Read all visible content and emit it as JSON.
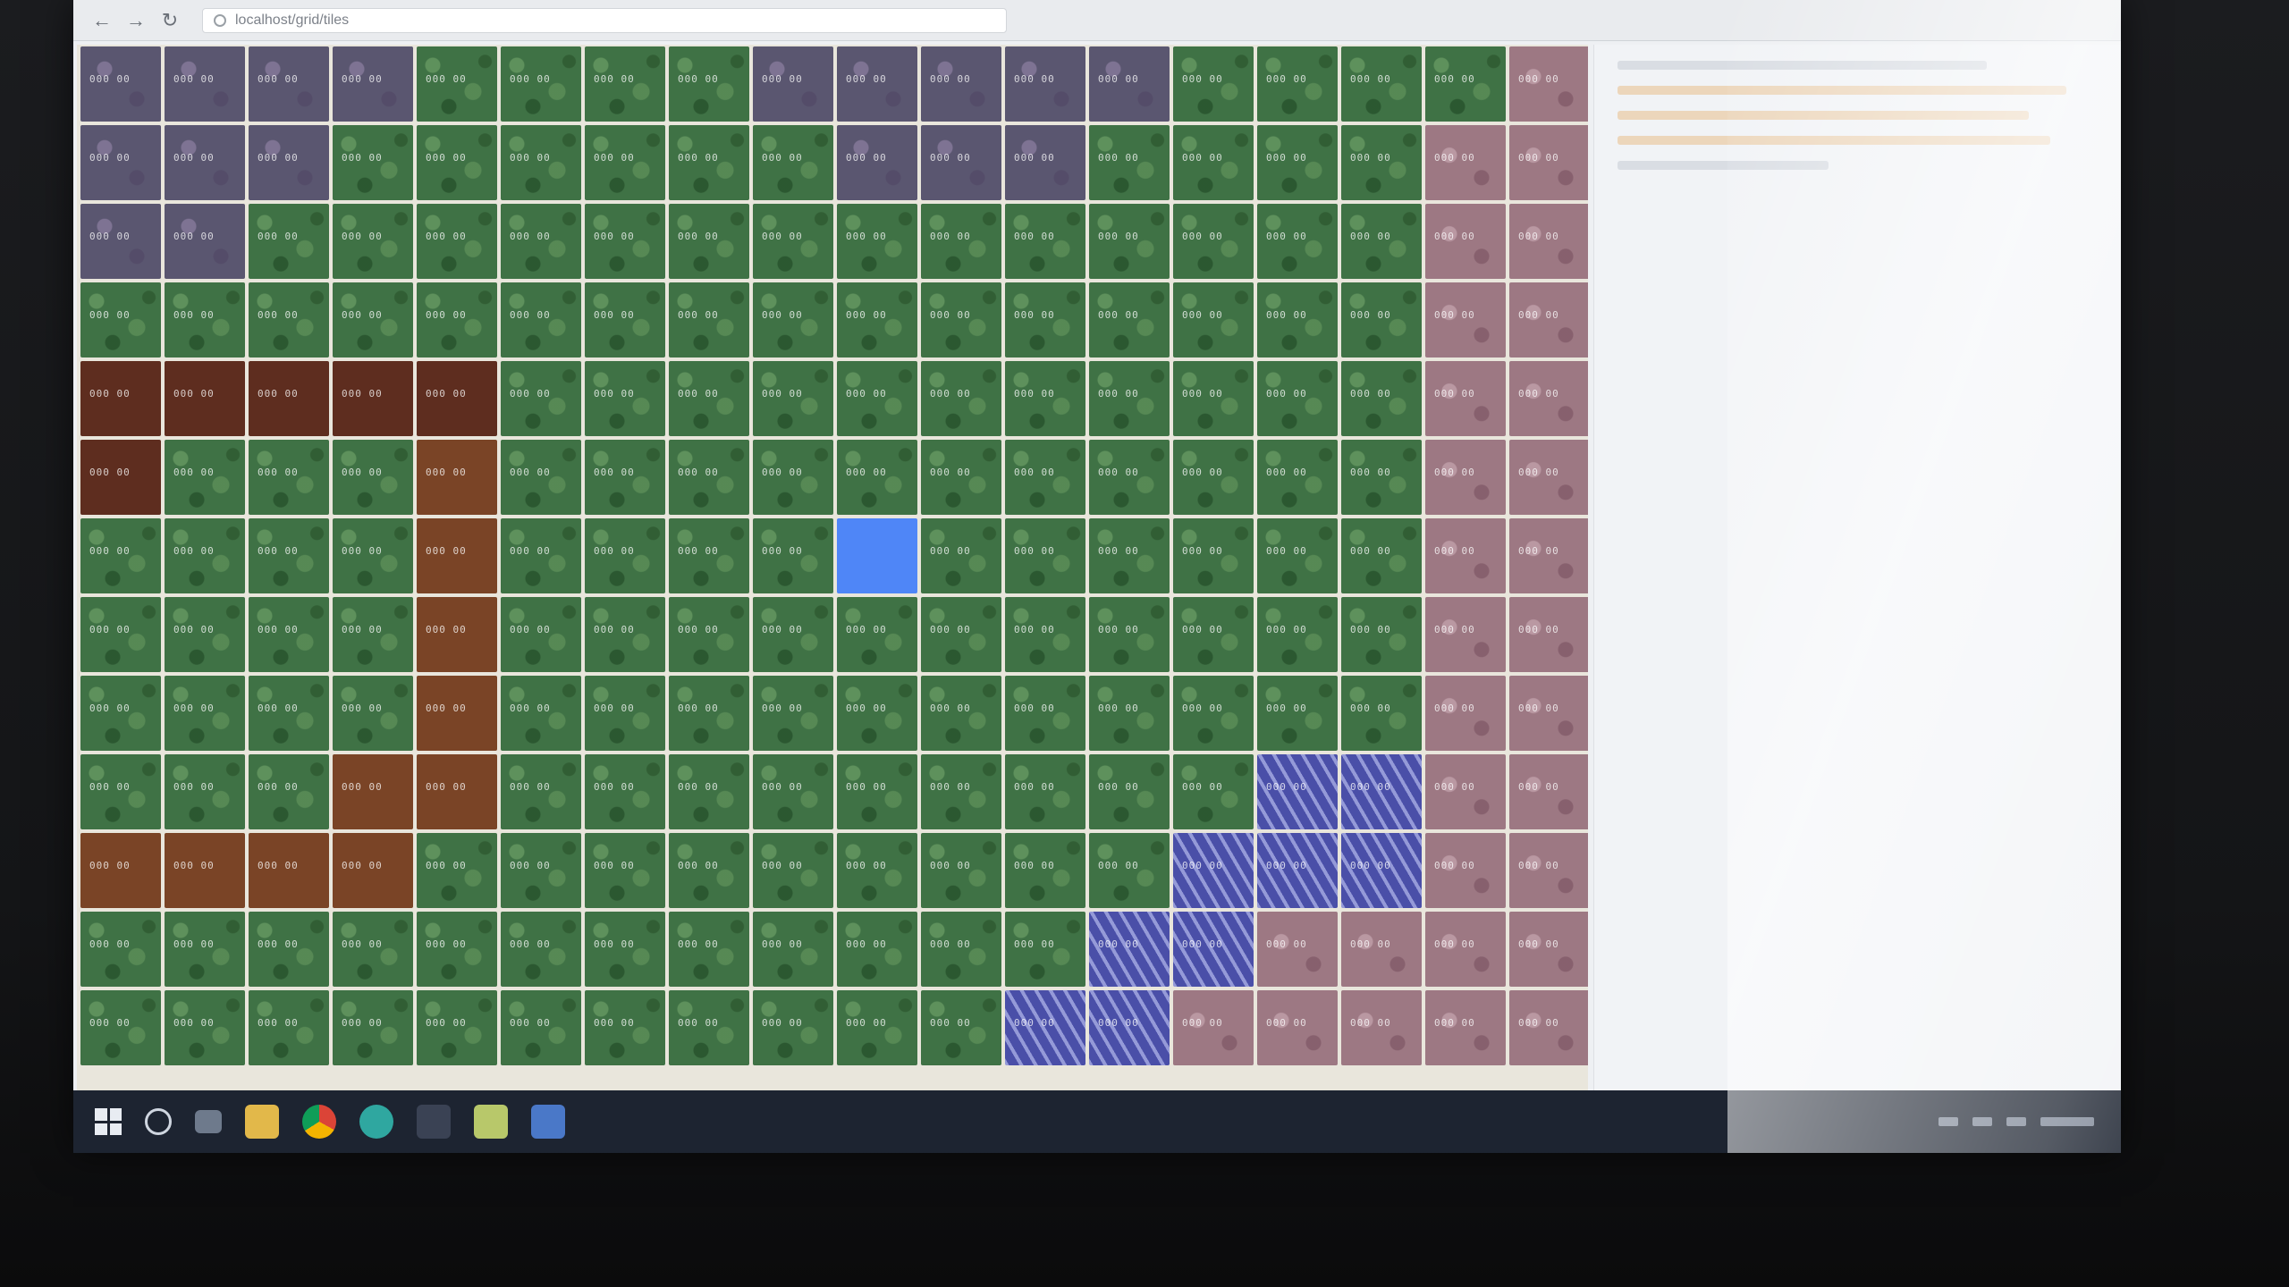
{
  "browser": {
    "url": "localhost/grid/tiles",
    "back_icon": "back-arrow-icon",
    "forward_icon": "forward-arrow-icon",
    "reload_icon": "reload-icon"
  },
  "map": {
    "columns": 18,
    "rows": 13,
    "tile_label": "000 00",
    "selected_tile": {
      "row": 6,
      "col": 9
    },
    "tile_types": {
      "grass": "#3f7245",
      "dirt": "#5e2d1f",
      "dirt2": "#7a4426",
      "stone": "#5a5670",
      "rose": "#9d7883",
      "water": "#4a4fa8",
      "selected": "#4f86f7"
    },
    "layout": [
      "SSSSGGGGSSSSSGGGGRR",
      "SSSGGGGGGSSSGGGGRR",
      "SSGGGGGGGGGGGGGGRR",
      "GGGGGGGGGGGGGGGGRR",
      "DDDDDGGGGGGGGGGGRR",
      "DGGGdGGGGGGGGGGGRR",
      "GGGGdGGGGXGGGGGGRR",
      "GGGGdGGGGGGGGGGGRR",
      "GGGGdGGGGGGGGGGGRR",
      "GGGddGGGGGGGGGWWRR",
      "ddddGGGGGGGGGWWWRR",
      "GGGGGGGGGGGGWWRRRR",
      "GGGGGGGGGGGWWRRRRR"
    ]
  },
  "panel": {
    "title": ""
  },
  "taskbar": {
    "icons": [
      "windows-start-icon",
      "search-icon",
      "task-view-icon",
      "file-explorer-icon",
      "chrome-icon",
      "edge-icon",
      "app-icon",
      "notepad-icon",
      "document-icon"
    ]
  }
}
